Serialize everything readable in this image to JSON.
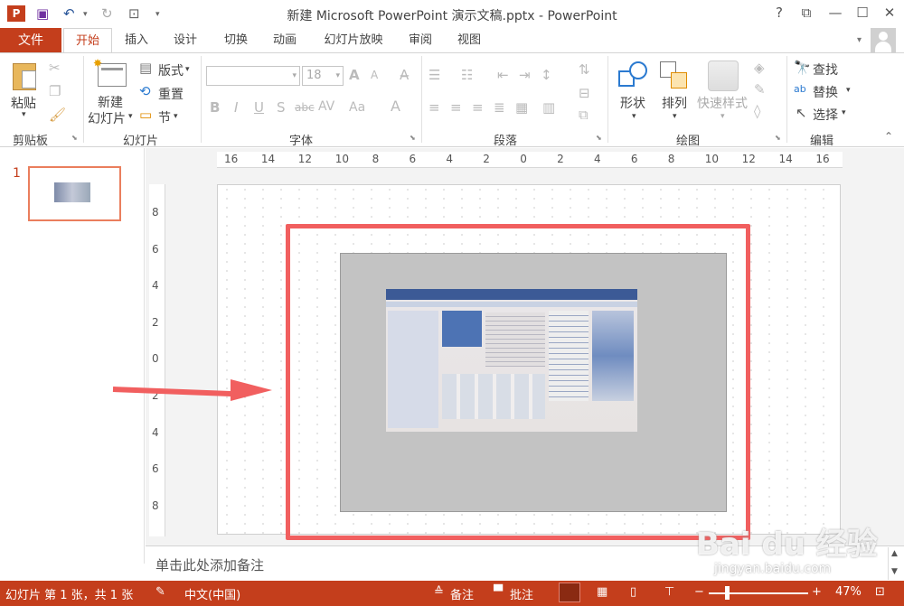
{
  "window": {
    "title": "新建 Microsoft PowerPoint 演示文稿.pptx - PowerPoint",
    "help": "?",
    "restore": "⧉",
    "minimize": "—",
    "maximize": "☐",
    "close": "✕"
  },
  "tabs": {
    "file": "文件",
    "items": [
      "开始",
      "插入",
      "设计",
      "切换",
      "动画",
      "幻灯片放映",
      "审阅",
      "视图"
    ]
  },
  "ribbon": {
    "clipboard": {
      "paste": "粘贴",
      "group": "剪贴板"
    },
    "slides": {
      "new_slide_line1": "新建",
      "new_slide_line2": "幻灯片",
      "layout": "版式",
      "reset": "重置",
      "section": "节",
      "group": "幻灯片"
    },
    "font": {
      "size": "18",
      "group": "字体",
      "bold": "B",
      "italic": "I",
      "underline": "U",
      "shadow": "S",
      "strike": "abc",
      "spacing": "AV",
      "case": "Aa",
      "color": "A",
      "grow": "A",
      "shrink": "A"
    },
    "paragraph": {
      "group": "段落"
    },
    "drawing": {
      "shapes": "形状",
      "arrange": "排列",
      "quick_styles": "快速样式",
      "group": "绘图"
    },
    "editing": {
      "find": "查找",
      "replace": "替换",
      "select": "选择",
      "group": "编辑"
    }
  },
  "thumbnail": {
    "number": "1"
  },
  "ruler": {
    "h_ticks": [
      "16",
      "14",
      "12",
      "10",
      "8",
      "6",
      "4",
      "2",
      "0",
      "2",
      "4",
      "6",
      "8",
      "10",
      "12",
      "14",
      "16"
    ],
    "v_ticks": [
      "8",
      "6",
      "4",
      "2",
      "0",
      "2",
      "4",
      "6",
      "8"
    ]
  },
  "notes": {
    "placeholder": "单击此处添加备注"
  },
  "status": {
    "slide_info": "幻灯片 第 1 张，共 1 张",
    "language": "中文(中国)",
    "notes_btn": "备注",
    "comments_btn": "批注",
    "zoom_minus": "−",
    "zoom_plus": "+",
    "zoom": "47%"
  },
  "watermark": {
    "text": "Bai du 经验",
    "url": "jingyan.baidu.com"
  },
  "colors": {
    "accent": "#c43e1c",
    "highlight": "#f15f5f"
  }
}
